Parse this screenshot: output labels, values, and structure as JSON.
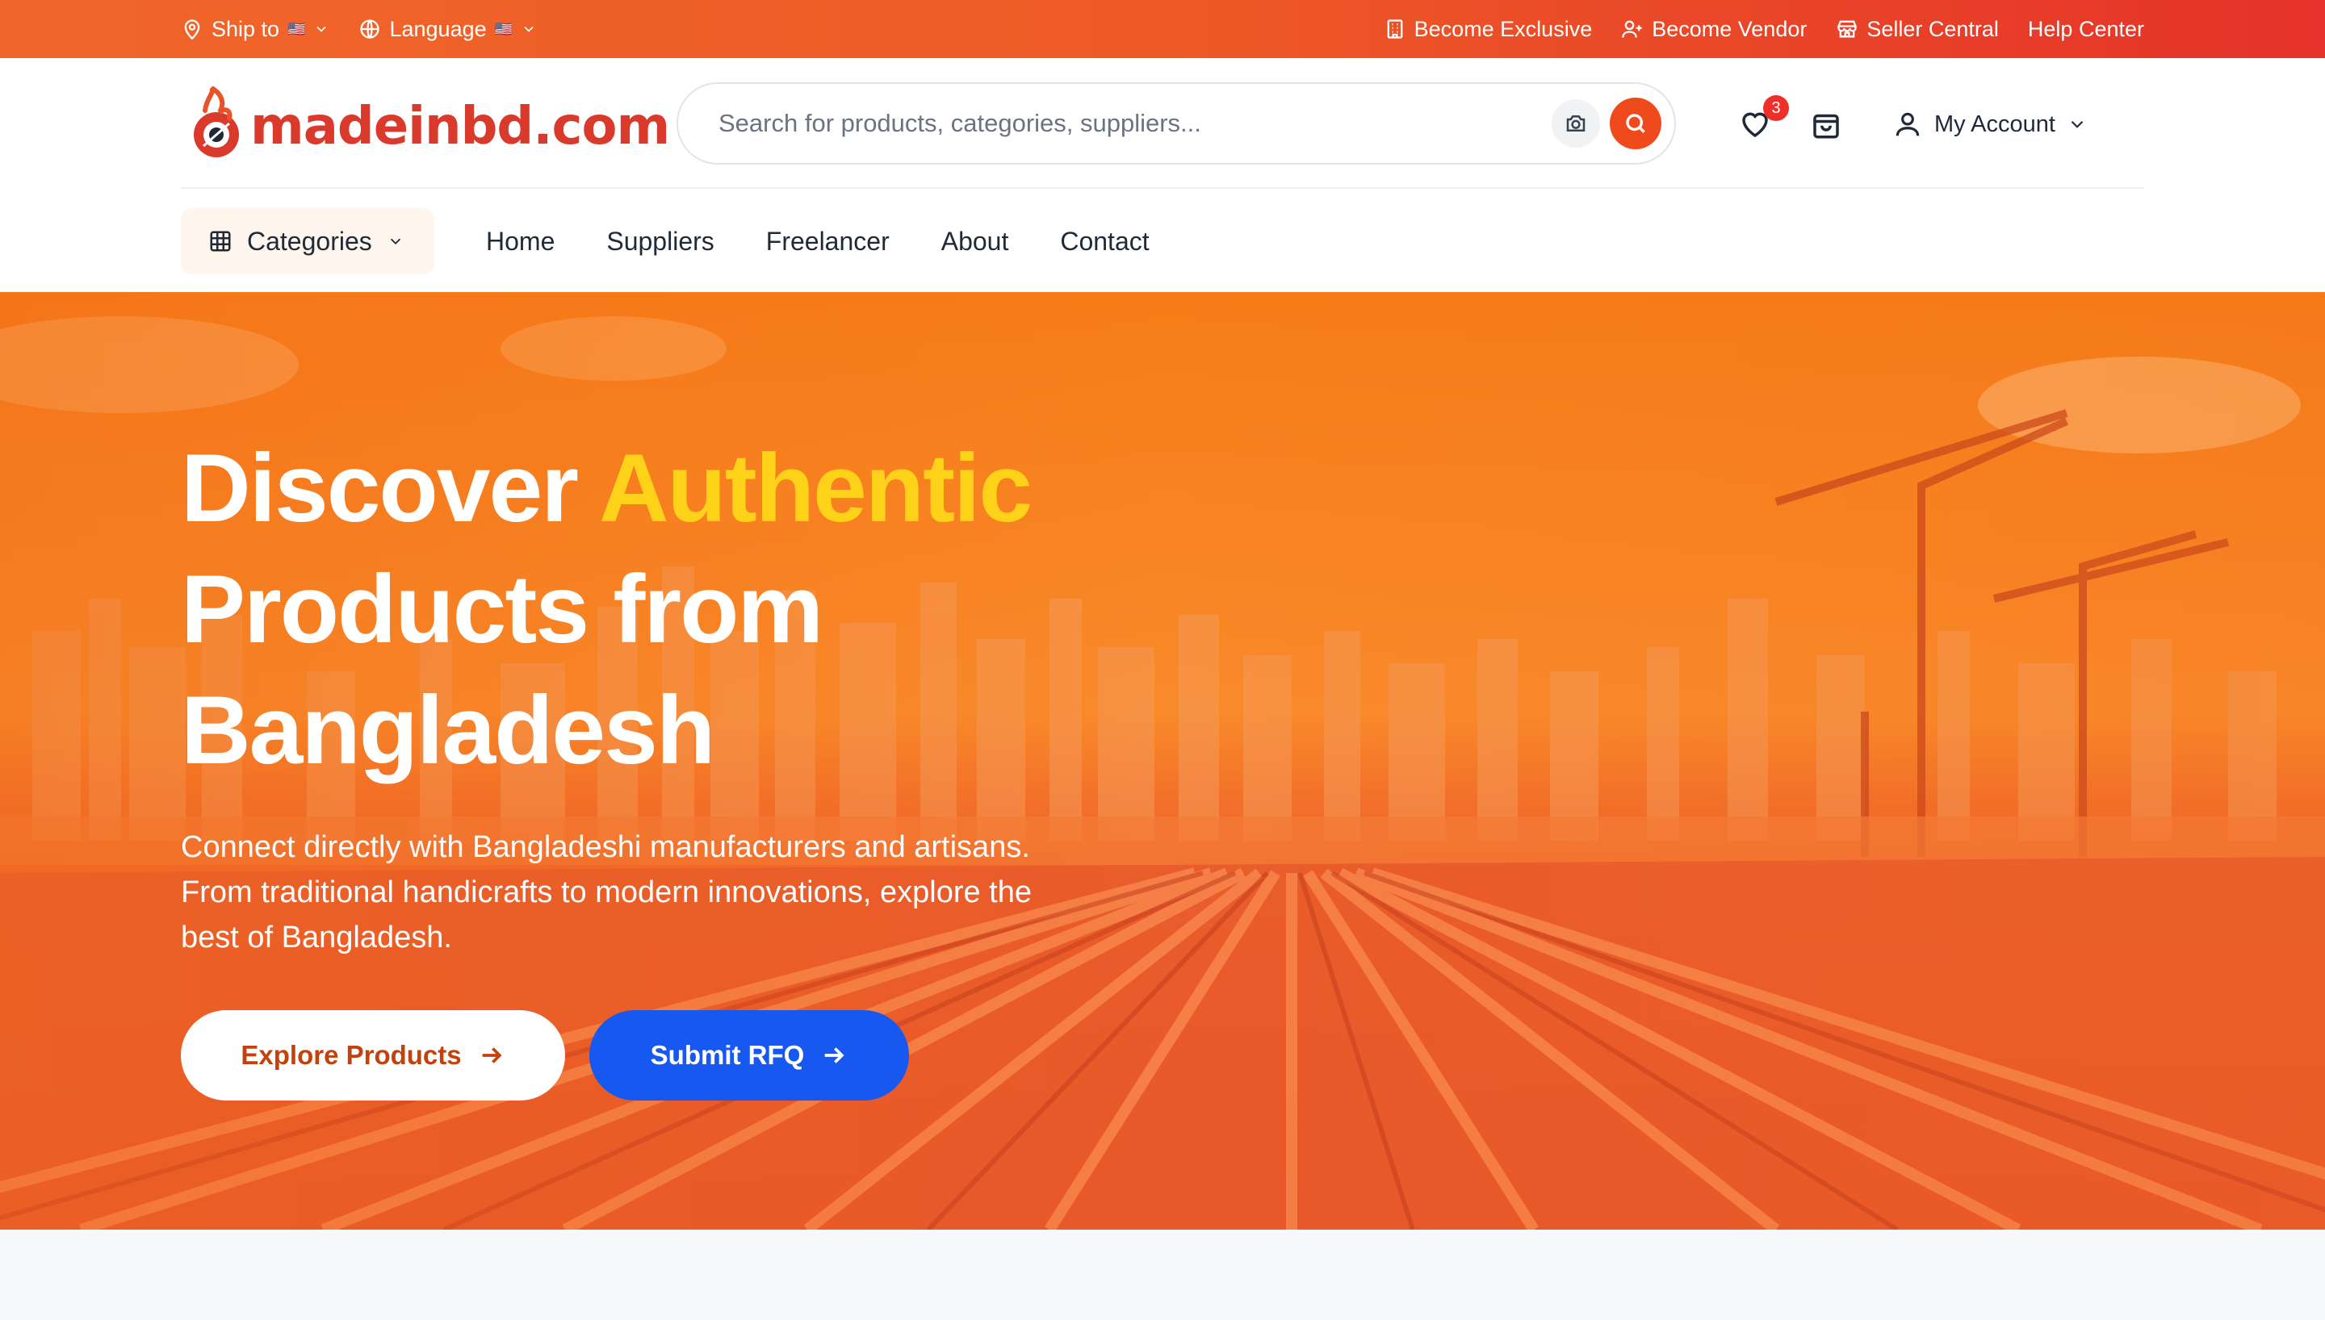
{
  "topbar": {
    "ship_to": "Ship to",
    "ship_flag": "🇺🇸",
    "language": "Language",
    "language_flag": "🇺🇸",
    "become_exclusive": "Become Exclusive",
    "become_vendor": "Become Vendor",
    "seller_central": "Seller Central",
    "help_center": "Help Center"
  },
  "header": {
    "logo_text": "madeinbd.com",
    "search_placeholder": "Search for products, categories, suppliers...",
    "wishlist_count": "3",
    "account_label": "My Account"
  },
  "nav": {
    "categories": "Categories",
    "links": [
      "Home",
      "Suppliers",
      "Freelancer",
      "About",
      "Contact"
    ]
  },
  "hero": {
    "title_part1": "Discover",
    "title_accent": "Authentic",
    "title_part2": "Products from Bangladesh",
    "subtitle": "Connect directly with Bangladeshi manufacturers and artisans. From traditional handicrafts to modern innovations, explore the best of Bangladesh.",
    "explore_button": "Explore Products",
    "rfq_button": "Submit RFQ"
  },
  "colors": {
    "brand_orange": "#ef4a1c",
    "accent_yellow": "#ffd21a",
    "rfq_blue": "#1759f0",
    "badge_red": "#ef2f2a"
  }
}
